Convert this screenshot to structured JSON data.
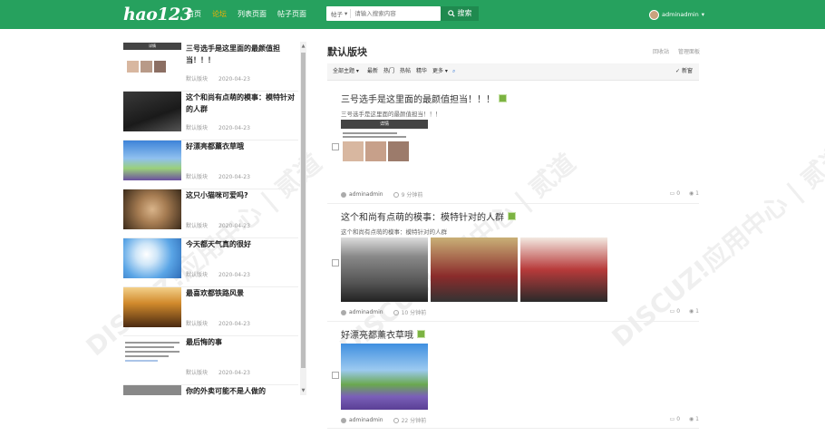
{
  "header": {
    "logo": "hao123",
    "nav": [
      {
        "label": "首页",
        "active": false
      },
      {
        "label": "论坛",
        "active": true
      },
      {
        "label": "列表页面",
        "active": false
      },
      {
        "label": "帖子页面",
        "active": false
      }
    ],
    "search_scope": "帖子",
    "search_placeholder": "请输入搜索内容",
    "search_button": "搜索",
    "username": "adminadmin"
  },
  "left_list": [
    {
      "title": "三号选手是这里面的最颜值担当！！！",
      "forum": "默认版块",
      "date": "2020-04-23"
    },
    {
      "title": "这个和尚有点萌的模事：模特针对的人群",
      "forum": "默认版块",
      "date": "2020-04-23"
    },
    {
      "title": "好漂亮都薰衣草哦",
      "forum": "默认版块",
      "date": "2020-04-23"
    },
    {
      "title": "这只小猫咪可爱吗?",
      "forum": "默认版块",
      "date": "2020-04-23"
    },
    {
      "title": "今天都天气真的很好",
      "forum": "默认版块",
      "date": "2020-04-23"
    },
    {
      "title": "最喜欢都铁路风景",
      "forum": "默认版块",
      "date": "2020-04-23"
    },
    {
      "title": "最后悔的事",
      "forum": "默认版块",
      "date": "2020-04-23"
    },
    {
      "title": "你的外卖可能不是人做的",
      "forum": "默认版块",
      "date": "2020-04-23"
    }
  ],
  "right": {
    "board_title": "默认版块",
    "links": [
      "回收站",
      "管理面板"
    ],
    "filters": [
      "全部主题",
      "最新",
      "热门",
      "热帖",
      "精华",
      "更多"
    ],
    "new_window": "新窗",
    "posts": [
      {
        "title": "三号选手是这里面的最颜值担当！！！",
        "excerpt": "三号选手是这里面的最颜值担当！！！",
        "author": "adminadmin",
        "time": "9 分钟前",
        "replies": "0",
        "views": "1"
      },
      {
        "title": "这个和尚有点萌的模事：模特针对的人群",
        "excerpt": "这个和尚有点萌的模事：模特针对的人群",
        "author": "adminadmin",
        "time": "10 分钟前",
        "replies": "0",
        "views": "1"
      },
      {
        "title": "好漂亮都薰衣草哦",
        "author": "adminadmin",
        "time": "22 分钟前",
        "replies": "0",
        "views": "1"
      }
    ]
  },
  "thumb_header_label": "详情",
  "watermark": "DISCUZ!应用中心 | 贰道"
}
